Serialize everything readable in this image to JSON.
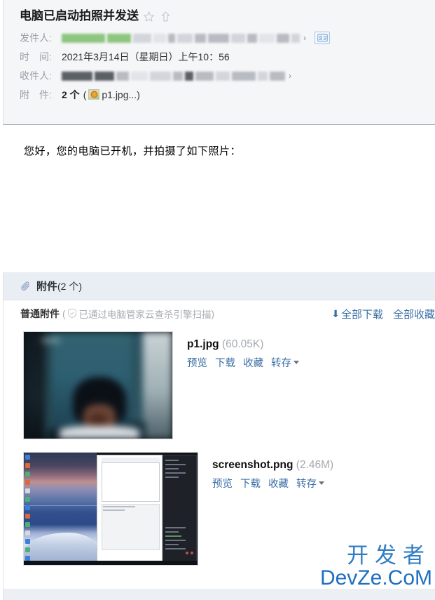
{
  "mail": {
    "subject": "电脑已启动拍照并发送",
    "star_icon": "star-icon",
    "flag_icon": "flag-up-icon",
    "fields": {
      "sender_label": "发件人:",
      "time_label": "时　间:",
      "recipient_label": "收件人:",
      "attachment_label": "附　件:",
      "time_value": "2021年3月14日（星期日）上午10：56",
      "attachment_count": "2 个",
      "attachment_open_paren": "(",
      "attachment_first_name": "p1.jpg...",
      "attachment_close_paren": ")",
      "contact_card_icon": "contact-card-icon"
    }
  },
  "body": {
    "text": "您好，您的电脑已开机，并拍摄了如下照片："
  },
  "attachments_panel": {
    "clip_icon": "paperclip-icon",
    "title": "附件",
    "count_label": "(2 个)",
    "group_title": "普通附件",
    "scan_open": "(",
    "scan_text": "已通过电脑管家云查杀引擎扫描",
    "scan_close": ")",
    "shield_icon": "shield-check-icon",
    "download_all": "全部下载",
    "favorite_all": "全部收藏",
    "download_arrow_icon": "download-arrow-icon",
    "items": [
      {
        "name": "p1.jpg",
        "size": "(60.05K)",
        "thumbnail": "photo-thumbnail",
        "actions": [
          "预览",
          "下载",
          "收藏",
          "转存"
        ]
      },
      {
        "name": "screenshot.png",
        "size": "(2.46M)",
        "thumbnail": "screenshot-thumbnail",
        "actions": [
          "预览",
          "下载",
          "收藏",
          "转存"
        ]
      }
    ]
  },
  "watermark": {
    "cn": "开发者",
    "en": "DevZe.CoM",
    "color": "#2f7dc4"
  },
  "colors": {
    "link": "#3a6ea5",
    "header_bg": "#f5f6f8",
    "attach_head_bg": "#e9edf4",
    "muted_text": "#9a9ea6"
  }
}
